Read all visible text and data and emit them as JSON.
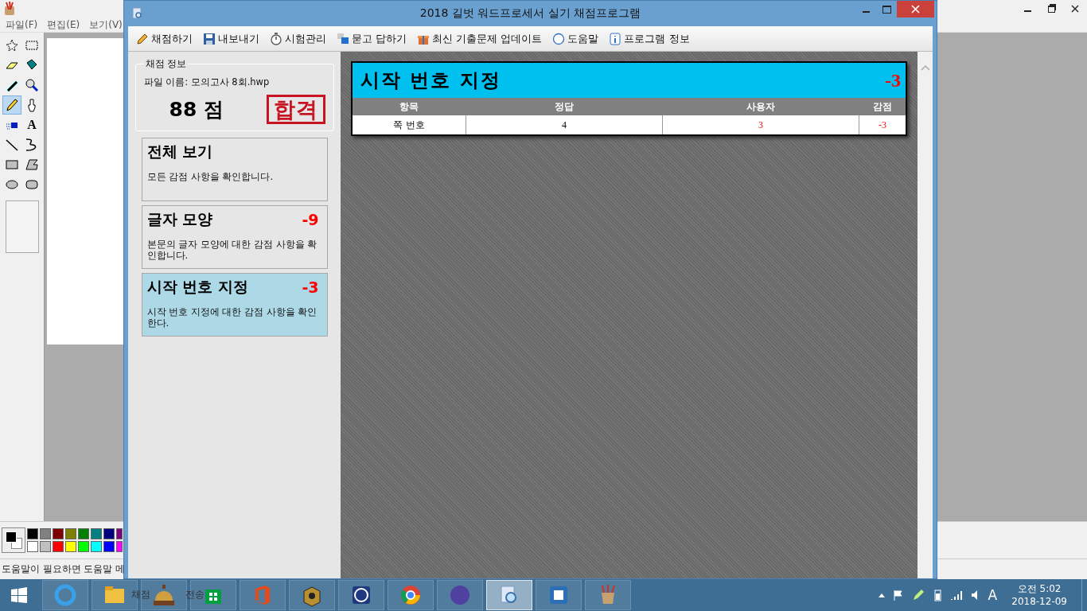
{
  "paint_window": {
    "menu": [
      "파일(F)",
      "편집(E)",
      "보기(V)"
    ],
    "tools": [
      {
        "selected": false
      },
      {
        "selected": false
      },
      {
        "selected": false
      },
      {
        "selected": false
      },
      {
        "selected": false
      },
      {
        "selected": false
      },
      {
        "selected": true
      },
      {
        "selected": false
      },
      {
        "selected": false
      },
      {
        "glyph": "A",
        "selected": false
      },
      {
        "selected": false
      },
      {
        "selected": false
      },
      {
        "selected": false
      },
      {
        "selected": false
      },
      {
        "selected": false
      },
      {
        "selected": false
      }
    ],
    "palette": [
      {
        "color": "#000000"
      },
      {
        "color": "#808080"
      },
      {
        "color": "#800000"
      },
      {
        "color": "#808000"
      },
      {
        "color": "#008000"
      },
      {
        "color": "#008080"
      },
      {
        "color": "#000080"
      },
      {
        "color": "#800080"
      },
      {
        "color": "#ffffff"
      },
      {
        "color": "#c0c0c0"
      },
      {
        "color": "#ff0000"
      },
      {
        "color": "#ffff00"
      },
      {
        "color": "#00ff00"
      },
      {
        "color": "#00ffff"
      },
      {
        "color": "#0000ff"
      },
      {
        "color": "#ff00ff"
      }
    ],
    "status_text": "도움말이 필요하면 도움말 메"
  },
  "app": {
    "title": "2018 길벗 워드프로세서 실기 채점프로그램",
    "toolbar": [
      {
        "label": "채점하기"
      },
      {
        "label": "내보내기"
      },
      {
        "label": "시험관리"
      },
      {
        "label": "묻고 답하기"
      },
      {
        "label": "최신 기출문제 업데이트"
      },
      {
        "label": "도움말"
      },
      {
        "label": "프로그램 정보"
      }
    ],
    "score_info": {
      "legend": "채점 정보",
      "file_name": "파일 이름: 모의고사 8회.hwp",
      "score": "88 점",
      "stamp": "합격"
    },
    "categories": [
      {
        "title": "전체 보기",
        "description": "모든 감점 사항을 확인합니다.",
        "selected": false
      },
      {
        "title": "글자 모양",
        "deduction": "-9",
        "description": "본문의 글자 모양에 대한 감점 사항을 확인합니다.",
        "selected": false
      },
      {
        "title": "시작 번호 지정",
        "deduction": "-3",
        "description": "시작 번호 지정에 대한 감점 사항을 확인한다.",
        "selected": true
      }
    ],
    "detail": {
      "title": "시작 번호 지정",
      "deduction": "-3",
      "columns": [
        "항목",
        "정답",
        "사용자",
        "감점"
      ],
      "rows": [
        [
          "쪽 번호",
          "4",
          "3",
          "-3"
        ]
      ]
    }
  },
  "taskbar": {
    "apps": [
      {
        "selected": false
      },
      {
        "selected": false
      },
      {
        "selected": false
      },
      {
        "selected": false
      },
      {
        "selected": false
      },
      {
        "selected": false
      },
      {
        "selected": false
      },
      {
        "selected": false
      },
      {
        "selected": false
      },
      {
        "selected": true
      },
      {
        "selected": false
      },
      {
        "selected": false
      }
    ],
    "preview": [
      "채점",
      "전송"
    ],
    "tray": {
      "ime": "A",
      "time": "오전 5:02",
      "date": "2018-12-09"
    }
  }
}
